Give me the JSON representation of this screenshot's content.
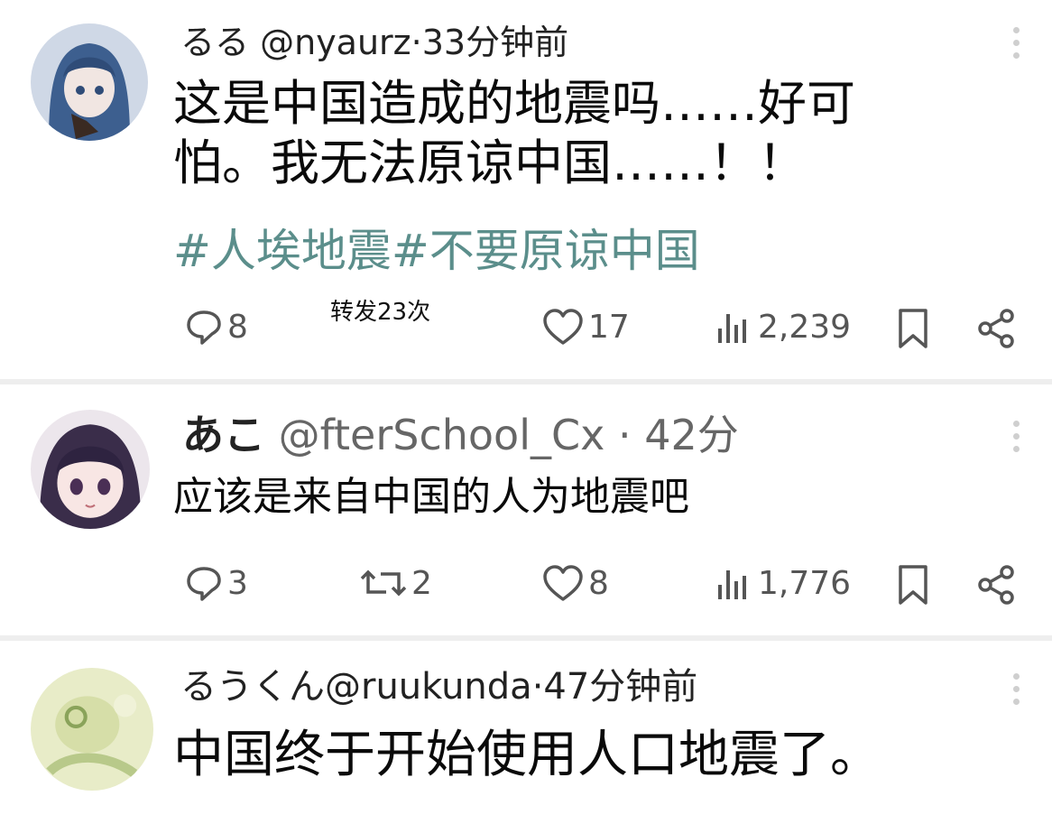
{
  "posts": [
    {
      "author": "るる",
      "handle": "@nyaurz",
      "sep": "·",
      "time": "33分钟前",
      "text_lines": [
        "这是中国造成的地震吗……好可",
        "怕。我无法原谅中国……！！"
      ],
      "hashtags": [
        "#人埃地震",
        "#不要原谅中国"
      ],
      "repost_note": "转发23次",
      "replies": "8",
      "likes": "17",
      "views": "2,239",
      "avatar_colors": {
        "bg": "#cfd8e6",
        "hair": "#3d5f8f",
        "face": "#f1e6e2"
      }
    },
    {
      "author": "あこ",
      "handle": "@fterSchool_Cx",
      "sep": " · ",
      "time": "42分",
      "text_lines": [
        "应该是来自中国的人为地震吧"
      ],
      "replies": "3",
      "retweets": "2",
      "likes": "8",
      "views": "1,776",
      "avatar_colors": {
        "bg": "#ece6ec",
        "hair": "#3a2d4a",
        "face": "#f8e6e4"
      }
    },
    {
      "author": "るうくん",
      "handle": "@ruukunda",
      "sep": "·",
      "time": "47分钟前",
      "text_lines": [
        "中国终于开始使用人口地震了。"
      ],
      "avatar_colors": {
        "bg": "#e8ecc8",
        "hair": "#b8c98a",
        "face": "#d6dea8"
      }
    }
  ],
  "colors": {
    "hashtag": "#5b8e8b",
    "icon": "#555555",
    "divider": "#eeeeee"
  }
}
